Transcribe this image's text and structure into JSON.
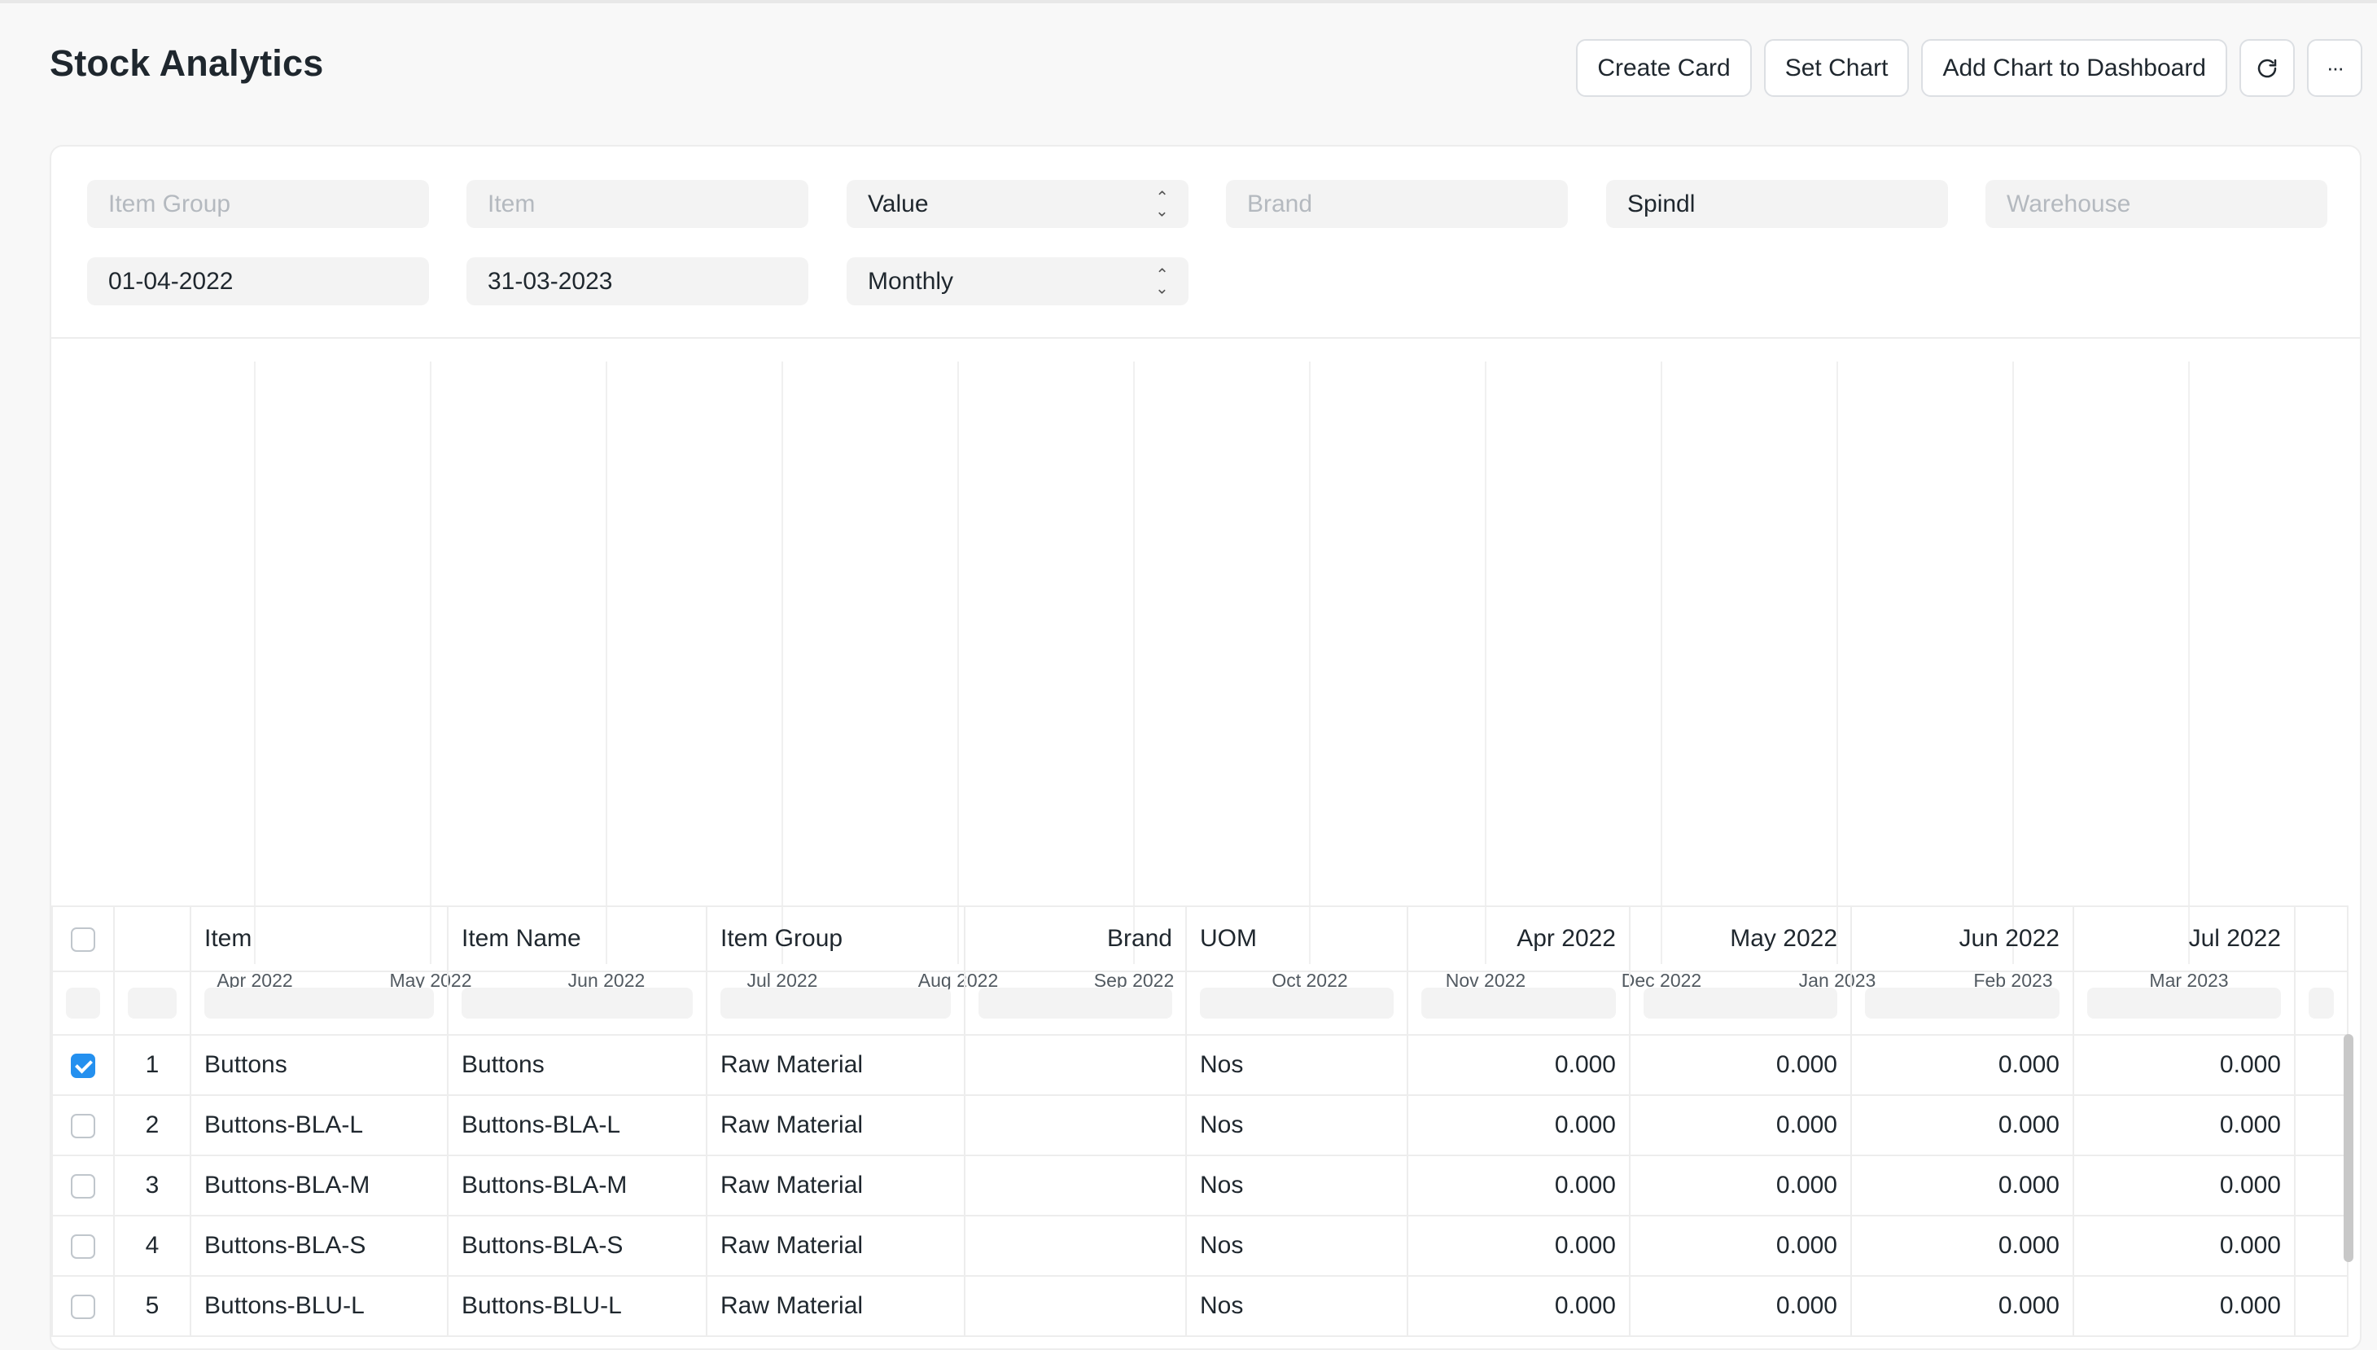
{
  "page": {
    "title": "Stock Analytics"
  },
  "actions": {
    "create_card": "Create Card",
    "set_chart": "Set Chart",
    "add_chart": "Add Chart to Dashboard",
    "refresh_icon": "refresh-icon",
    "more_icon": "more-icon",
    "more_label": "···"
  },
  "filters": {
    "item_group": {
      "placeholder": "Item Group",
      "value": ""
    },
    "item": {
      "placeholder": "Item",
      "value": ""
    },
    "value_type": {
      "value": "Value"
    },
    "brand": {
      "placeholder": "Brand",
      "value": ""
    },
    "company": {
      "value": "Spindl"
    },
    "warehouse": {
      "placeholder": "Warehouse",
      "value": ""
    },
    "from_date": {
      "value": "01-04-2022"
    },
    "to_date": {
      "value": "31-03-2023"
    },
    "range": {
      "value": "Monthly"
    }
  },
  "chart_data": {
    "type": "line",
    "x": [
      "Apr 2022",
      "May 2022",
      "Jun 2022",
      "Jul 2022",
      "Aug 2022",
      "Sep 2022",
      "Oct 2022",
      "Nov 2022",
      "Dec 2022",
      "Jan 2023",
      "Feb 2023",
      "Mar 2023"
    ],
    "series": [],
    "grid": true
  },
  "table": {
    "columns": [
      "Item",
      "Item Name",
      "Item Group",
      "Brand",
      "UOM",
      "Apr 2022",
      "May 2022",
      "Jun 2022",
      "Jul 2022"
    ],
    "rows": [
      {
        "no": "1",
        "checked": true,
        "cells": [
          "Buttons",
          "Buttons",
          "Raw Material",
          "",
          "Nos",
          "0.000",
          "0.000",
          "0.000",
          "0.000"
        ]
      },
      {
        "no": "2",
        "checked": false,
        "cells": [
          "Buttons-BLA-L",
          "Buttons-BLA-L",
          "Raw Material",
          "",
          "Nos",
          "0.000",
          "0.000",
          "0.000",
          "0.000"
        ]
      },
      {
        "no": "3",
        "checked": false,
        "cells": [
          "Buttons-BLA-M",
          "Buttons-BLA-M",
          "Raw Material",
          "",
          "Nos",
          "0.000",
          "0.000",
          "0.000",
          "0.000"
        ]
      },
      {
        "no": "4",
        "checked": false,
        "cells": [
          "Buttons-BLA-S",
          "Buttons-BLA-S",
          "Raw Material",
          "",
          "Nos",
          "0.000",
          "0.000",
          "0.000",
          "0.000"
        ]
      },
      {
        "no": "5",
        "checked": false,
        "cells": [
          "Buttons-BLU-L",
          "Buttons-BLU-L",
          "Raw Material",
          "",
          "Nos",
          "0.000",
          "0.000",
          "0.000",
          "0.000"
        ]
      }
    ]
  },
  "colors": {
    "accent": "#2490ef",
    "border": "#ededed"
  }
}
